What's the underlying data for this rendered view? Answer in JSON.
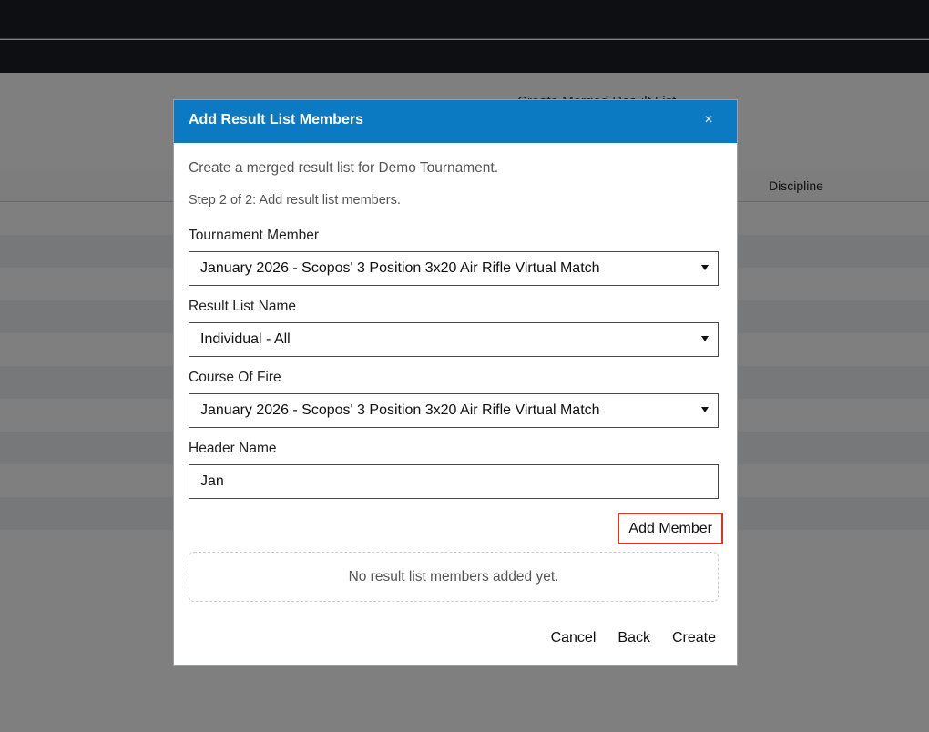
{
  "background": {
    "heading": "Create Merged Result List",
    "table_header_discipline": "Discipline"
  },
  "modal": {
    "title": "Add Result List Members",
    "close_glyph": "×",
    "intro": "Create a merged result list for Demo Tournament.",
    "step": "Step 2 of 2: Add result list members.",
    "tournament_member": {
      "label": "Tournament Member",
      "value": "January 2026 - Scopos' 3 Position 3x20 Air Rifle Virtual Match"
    },
    "result_list_name": {
      "label": "Result List Name",
      "value": "Individual - All"
    },
    "course_of_fire": {
      "label": "Course Of Fire",
      "value": "January 2026 - Scopos' 3 Position 3x20 Air Rifle Virtual Match"
    },
    "header_name": {
      "label": "Header Name",
      "value": "Jan"
    },
    "add_member_label": "Add Member",
    "empty_members": "No result list members added yet.",
    "buttons": {
      "cancel": "Cancel",
      "back": "Back",
      "create": "Create"
    }
  },
  "colors": {
    "header_blue": "#0c79c3",
    "highlight_red": "#d9351f",
    "topbar": "#1b1f27"
  }
}
